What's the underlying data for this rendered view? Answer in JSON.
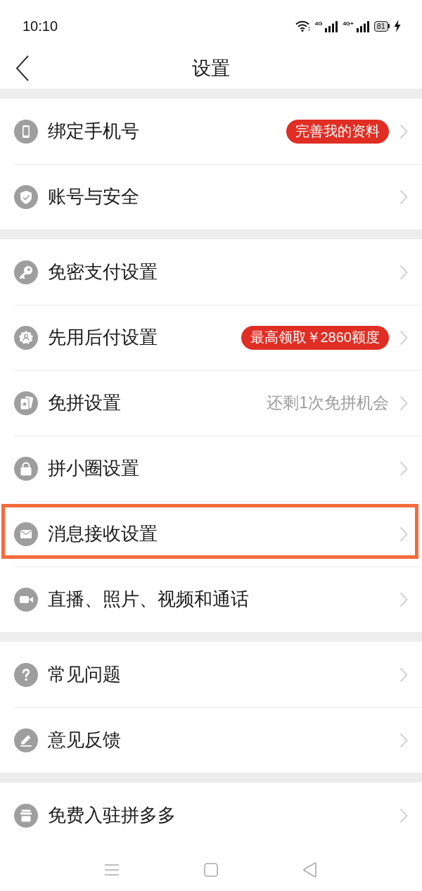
{
  "status_bar": {
    "time": "10:10",
    "networks": [
      {
        "label": "4G"
      },
      {
        "label": "4G+"
      }
    ],
    "battery": "81",
    "charging": true
  },
  "header": {
    "title": "设置"
  },
  "sections": [
    {
      "rows": [
        {
          "label": "绑定手机号",
          "kind": "badge",
          "trailing": "完善我的资料",
          "highlighted": false
        },
        {
          "label": "账号与安全",
          "kind": "plain",
          "highlighted": false
        }
      ]
    },
    {
      "rows": [
        {
          "label": "免密支付设置",
          "kind": "plain",
          "highlighted": false
        },
        {
          "label": "先用后付设置",
          "kind": "badge",
          "trailing": "最高领取￥2860额度",
          "highlighted": false
        },
        {
          "label": "免拼设置",
          "kind": "value",
          "trailing": "还剩1次免拼机会",
          "highlighted": false
        },
        {
          "label": "拼小圈设置",
          "kind": "plain",
          "highlighted": false
        },
        {
          "label": "消息接收设置",
          "kind": "plain",
          "highlighted": true
        },
        {
          "label": "直播、照片、视频和通话",
          "kind": "plain",
          "highlighted": false
        }
      ]
    },
    {
      "rows": [
        {
          "label": "常见问题",
          "kind": "plain",
          "highlighted": false
        },
        {
          "label": "意见反馈",
          "kind": "plain",
          "highlighted": false
        }
      ]
    },
    {
      "rows": [
        {
          "label": "免费入驻拼多多",
          "kind": "plain",
          "highlighted": false
        }
      ]
    }
  ]
}
